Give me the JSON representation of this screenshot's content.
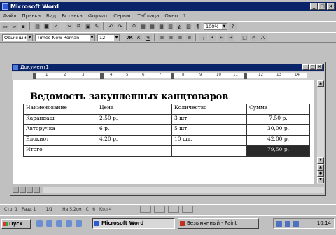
{
  "app": {
    "title": "Microsoft Word"
  },
  "menu": [
    "Файл",
    "Правка",
    "Вид",
    "Вставка",
    "Формат",
    "Сервис",
    "Таблица",
    "Окно",
    "?"
  ],
  "format_bar": {
    "style": "Обычный",
    "font": "Times New Roman",
    "size": "12"
  },
  "standard_bar": {
    "zoom": "100%"
  },
  "document": {
    "window_title": "Документ1",
    "heading": "Ведомость закупленных канцтоваров",
    "table": {
      "headers": [
        "Наименование",
        "Цена",
        "Количество",
        "Сумма"
      ],
      "rows": [
        [
          "Карандаш",
          "2,50 р.",
          "3 шт.",
          "7,50 р."
        ],
        [
          "Авторучка",
          "6 р.",
          "5 шт.",
          "30,00 р."
        ],
        [
          "Блокнот",
          "4,20 р.",
          "10 шт.",
          "42,00 р."
        ],
        [
          "Итого",
          "",
          "",
          "79,50 р."
        ]
      ]
    }
  },
  "ruler": {
    "numbers": [
      "1",
      "2",
      "3",
      "4",
      "5",
      "6",
      "7",
      "8",
      "9",
      "10",
      "11",
      "12",
      "13",
      "14"
    ]
  },
  "status": {
    "page": "Стр. 1",
    "section": "Разд 1",
    "pages": "1/1",
    "at": "На 5,2см",
    "line": "Ст 6",
    "col": "Кол 4"
  },
  "taskbar": {
    "start": "Пуск",
    "task_word": "Microsoft Word",
    "task_paint": "Безымянный - Paint",
    "clock": "10:14"
  },
  "colors": {
    "titlebar": "#0a246a",
    "face": "#c0c0c0",
    "page": "#ffffff"
  }
}
